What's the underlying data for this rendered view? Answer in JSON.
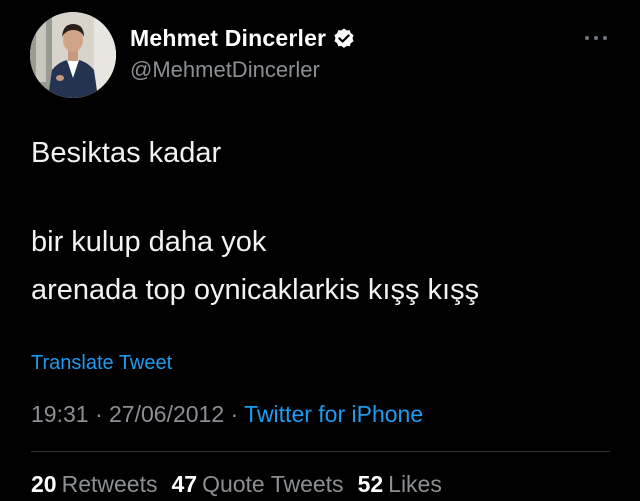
{
  "author": {
    "display_name": "Mehmet Dincerler",
    "handle": "@MehmetDincerler",
    "verified_icon": "verified-badge-icon",
    "avatar_icon": "profile-photo"
  },
  "menu": {
    "more_icon": "more-options-icon"
  },
  "tweet": {
    "line1": "Besiktas kadar",
    "line2": "bir kulup daha yok",
    "line3": "arenada top oynicaklarkis kışş kışş"
  },
  "translate": {
    "label": "Translate Tweet"
  },
  "meta": {
    "time": "19:31",
    "separator1": " · ",
    "date": "27/06/2012",
    "separator2": " · ",
    "source": "Twitter for iPhone"
  },
  "stats": {
    "retweets_count": "20",
    "retweets_label": "Retweets",
    "quotes_count": "47",
    "quotes_label": "Quote Tweets",
    "likes_count": "52",
    "likes_label": "Likes"
  },
  "colors": {
    "background": "#000000",
    "accent": "#1d9bf0",
    "secondary_text": "#8b8f94"
  }
}
